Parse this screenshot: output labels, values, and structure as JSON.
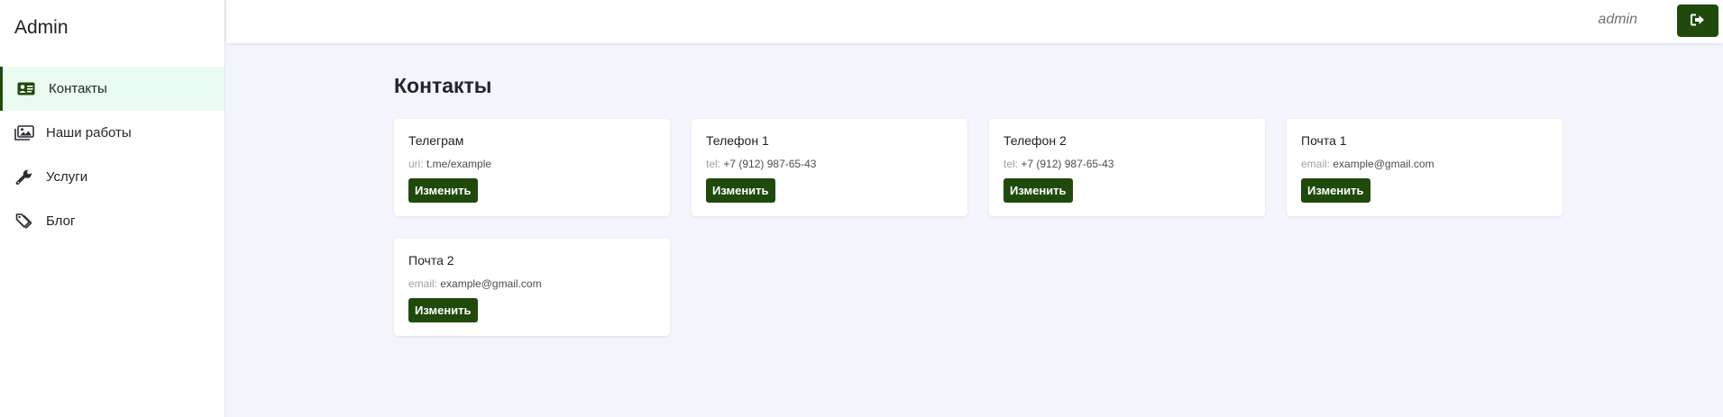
{
  "brand": "Admin",
  "nav": [
    {
      "label": "Контакты",
      "icon": "contact-card-icon",
      "active": true
    },
    {
      "label": "Наши работы",
      "icon": "images-icon",
      "active": false
    },
    {
      "label": "Услуги",
      "icon": "wrench-icon",
      "active": false
    },
    {
      "label": "Блог",
      "icon": "tags-icon",
      "active": false
    }
  ],
  "topbar": {
    "username": "admin",
    "logout_icon": "sign-out-icon"
  },
  "page": {
    "title": "Контакты"
  },
  "contacts": [
    {
      "title": "Телеграм",
      "key": "uri:",
      "value": "t.me/example",
      "button": "Изменить"
    },
    {
      "title": "Телефон 1",
      "key": "tel:",
      "value": "+7 (912) 987-65-43",
      "button": "Изменить"
    },
    {
      "title": "Телефон 2",
      "key": "tel:",
      "value": "+7 (912) 987-65-43",
      "button": "Изменить"
    },
    {
      "title": "Почта 1",
      "key": "email:",
      "value": "example@gmail.com",
      "button": "Изменить"
    },
    {
      "title": "Почта 2",
      "key": "email:",
      "value": "example@gmail.com",
      "button": "Изменить"
    }
  ],
  "colors": {
    "accent": "#1f4a0b",
    "active_bg": "#eafbf1",
    "background": "#f4f5fc"
  }
}
